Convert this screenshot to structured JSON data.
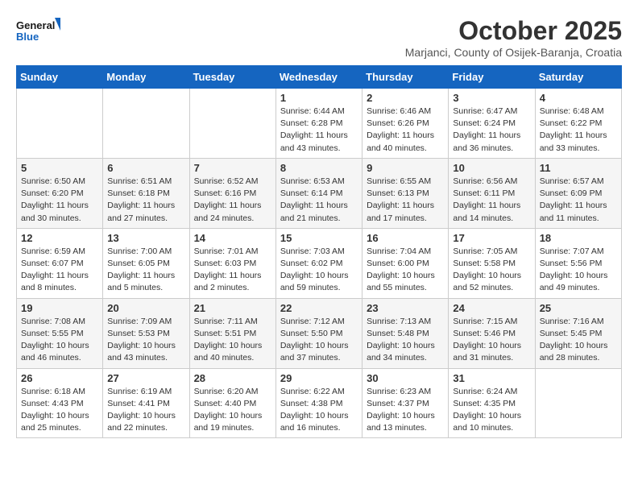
{
  "header": {
    "logo_line1": "General",
    "logo_line2": "Blue",
    "month_title": "October 2025",
    "subtitle": "Marjanci, County of Osijek-Baranja, Croatia"
  },
  "days_of_week": [
    "Sunday",
    "Monday",
    "Tuesday",
    "Wednesday",
    "Thursday",
    "Friday",
    "Saturday"
  ],
  "weeks": [
    [
      {
        "day": "",
        "info": ""
      },
      {
        "day": "",
        "info": ""
      },
      {
        "day": "",
        "info": ""
      },
      {
        "day": "1",
        "info": "Sunrise: 6:44 AM\nSunset: 6:28 PM\nDaylight: 11 hours\nand 43 minutes."
      },
      {
        "day": "2",
        "info": "Sunrise: 6:46 AM\nSunset: 6:26 PM\nDaylight: 11 hours\nand 40 minutes."
      },
      {
        "day": "3",
        "info": "Sunrise: 6:47 AM\nSunset: 6:24 PM\nDaylight: 11 hours\nand 36 minutes."
      },
      {
        "day": "4",
        "info": "Sunrise: 6:48 AM\nSunset: 6:22 PM\nDaylight: 11 hours\nand 33 minutes."
      }
    ],
    [
      {
        "day": "5",
        "info": "Sunrise: 6:50 AM\nSunset: 6:20 PM\nDaylight: 11 hours\nand 30 minutes."
      },
      {
        "day": "6",
        "info": "Sunrise: 6:51 AM\nSunset: 6:18 PM\nDaylight: 11 hours\nand 27 minutes."
      },
      {
        "day": "7",
        "info": "Sunrise: 6:52 AM\nSunset: 6:16 PM\nDaylight: 11 hours\nand 24 minutes."
      },
      {
        "day": "8",
        "info": "Sunrise: 6:53 AM\nSunset: 6:14 PM\nDaylight: 11 hours\nand 21 minutes."
      },
      {
        "day": "9",
        "info": "Sunrise: 6:55 AM\nSunset: 6:13 PM\nDaylight: 11 hours\nand 17 minutes."
      },
      {
        "day": "10",
        "info": "Sunrise: 6:56 AM\nSunset: 6:11 PM\nDaylight: 11 hours\nand 14 minutes."
      },
      {
        "day": "11",
        "info": "Sunrise: 6:57 AM\nSunset: 6:09 PM\nDaylight: 11 hours\nand 11 minutes."
      }
    ],
    [
      {
        "day": "12",
        "info": "Sunrise: 6:59 AM\nSunset: 6:07 PM\nDaylight: 11 hours\nand 8 minutes."
      },
      {
        "day": "13",
        "info": "Sunrise: 7:00 AM\nSunset: 6:05 PM\nDaylight: 11 hours\nand 5 minutes."
      },
      {
        "day": "14",
        "info": "Sunrise: 7:01 AM\nSunset: 6:03 PM\nDaylight: 11 hours\nand 2 minutes."
      },
      {
        "day": "15",
        "info": "Sunrise: 7:03 AM\nSunset: 6:02 PM\nDaylight: 10 hours\nand 59 minutes."
      },
      {
        "day": "16",
        "info": "Sunrise: 7:04 AM\nSunset: 6:00 PM\nDaylight: 10 hours\nand 55 minutes."
      },
      {
        "day": "17",
        "info": "Sunrise: 7:05 AM\nSunset: 5:58 PM\nDaylight: 10 hours\nand 52 minutes."
      },
      {
        "day": "18",
        "info": "Sunrise: 7:07 AM\nSunset: 5:56 PM\nDaylight: 10 hours\nand 49 minutes."
      }
    ],
    [
      {
        "day": "19",
        "info": "Sunrise: 7:08 AM\nSunset: 5:55 PM\nDaylight: 10 hours\nand 46 minutes."
      },
      {
        "day": "20",
        "info": "Sunrise: 7:09 AM\nSunset: 5:53 PM\nDaylight: 10 hours\nand 43 minutes."
      },
      {
        "day": "21",
        "info": "Sunrise: 7:11 AM\nSunset: 5:51 PM\nDaylight: 10 hours\nand 40 minutes."
      },
      {
        "day": "22",
        "info": "Sunrise: 7:12 AM\nSunset: 5:50 PM\nDaylight: 10 hours\nand 37 minutes."
      },
      {
        "day": "23",
        "info": "Sunrise: 7:13 AM\nSunset: 5:48 PM\nDaylight: 10 hours\nand 34 minutes."
      },
      {
        "day": "24",
        "info": "Sunrise: 7:15 AM\nSunset: 5:46 PM\nDaylight: 10 hours\nand 31 minutes."
      },
      {
        "day": "25",
        "info": "Sunrise: 7:16 AM\nSunset: 5:45 PM\nDaylight: 10 hours\nand 28 minutes."
      }
    ],
    [
      {
        "day": "26",
        "info": "Sunrise: 6:18 AM\nSunset: 4:43 PM\nDaylight: 10 hours\nand 25 minutes."
      },
      {
        "day": "27",
        "info": "Sunrise: 6:19 AM\nSunset: 4:41 PM\nDaylight: 10 hours\nand 22 minutes."
      },
      {
        "day": "28",
        "info": "Sunrise: 6:20 AM\nSunset: 4:40 PM\nDaylight: 10 hours\nand 19 minutes."
      },
      {
        "day": "29",
        "info": "Sunrise: 6:22 AM\nSunset: 4:38 PM\nDaylight: 10 hours\nand 16 minutes."
      },
      {
        "day": "30",
        "info": "Sunrise: 6:23 AM\nSunset: 4:37 PM\nDaylight: 10 hours\nand 13 minutes."
      },
      {
        "day": "31",
        "info": "Sunrise: 6:24 AM\nSunset: 4:35 PM\nDaylight: 10 hours\nand 10 minutes."
      },
      {
        "day": "",
        "info": ""
      }
    ]
  ]
}
